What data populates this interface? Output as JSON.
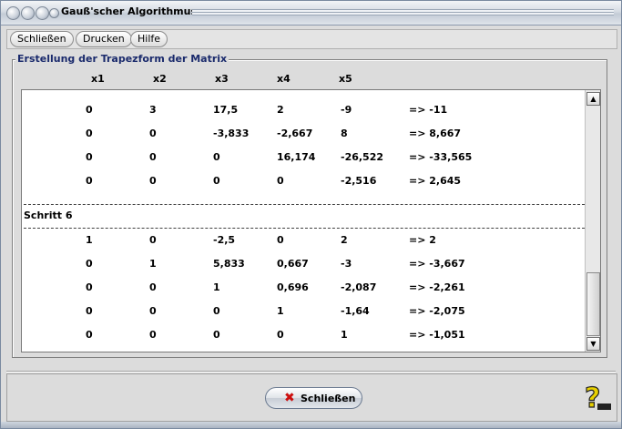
{
  "window": {
    "title": "Gauß'scher Algorithmus"
  },
  "menu": [
    {
      "label": "Schließen",
      "name": "menu-schliessen"
    },
    {
      "label": "Drucken",
      "name": "menu-drucken"
    },
    {
      "label": "Hilfe",
      "name": "menu-hilfe"
    }
  ],
  "group": {
    "title": "Erstellung der Trapezform der Matrix"
  },
  "columns": [
    "x1",
    "x2",
    "x3",
    "x4",
    "x5"
  ],
  "block1": [
    [
      "0",
      "3",
      "17,5",
      "2",
      "-9",
      "=> -11"
    ],
    [
      "0",
      "0",
      "-3,833",
      "-2,667",
      "8",
      "=> 8,667"
    ],
    [
      "0",
      "0",
      "0",
      "16,174",
      "-26,522",
      "=> -33,565"
    ],
    [
      "0",
      "0",
      "0",
      "0",
      "-2,516",
      "=> 2,645"
    ]
  ],
  "step_label": "Schritt 6",
  "block2": [
    [
      "1",
      "0",
      "-2,5",
      "0",
      "2",
      "=> 2"
    ],
    [
      "0",
      "1",
      "5,833",
      "0,667",
      "-3",
      "=> -3,667"
    ],
    [
      "0",
      "0",
      "1",
      "0,696",
      "-2,087",
      "=> -2,261"
    ],
    [
      "0",
      "0",
      "0",
      "1",
      "-1,64",
      "=> -2,075"
    ],
    [
      "0",
      "0",
      "0",
      "0",
      "1",
      "=> -1,051"
    ]
  ],
  "footer": {
    "close_label": "Schließen"
  },
  "icons": {
    "close": "close-x-icon",
    "help": "help-question-icon"
  },
  "colors": {
    "group_title": "#1a2a6c",
    "close_x": "#cc1010",
    "help": "#e8d000"
  }
}
